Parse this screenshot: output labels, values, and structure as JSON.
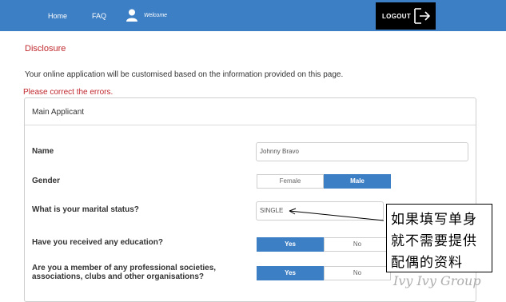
{
  "nav": {
    "home": "Home",
    "faq": "FAQ",
    "welcome": "Welcome",
    "logout": "LOGOUT",
    "user_icon": "user-icon",
    "logout_icon": "logout-arrow-icon"
  },
  "page": {
    "title": "Disclosure",
    "intro": "Your online application will be customised based on the information provided on this page.",
    "error": "Please correct the errors."
  },
  "panel": {
    "title": "Main Applicant",
    "name_label": "Name",
    "name_value": "Johnny Bravo",
    "gender_label": "Gender",
    "gender_options": [
      "Female",
      "Male"
    ],
    "gender_selected": "Male",
    "marital_label": "What is your marital status?",
    "marital_value": "SINGLE",
    "education_label": "Have you received any education?",
    "education_options": [
      "Yes",
      "No"
    ],
    "education_selected": "Yes",
    "member_label": "Are you a member of any professional societies, associations, clubs and other organisations?",
    "member_options": [
      "Yes",
      "No"
    ],
    "member_selected": "Yes"
  },
  "annotation": {
    "lines": [
      "如果填写单身",
      "就不需要提供",
      "配偶的资料"
    ],
    "watermark": "Ivy Ivy Group"
  },
  "colors": {
    "nav_bg": "#3d7fc4",
    "accent_blue": "#3d7fc4",
    "error_red": "#c0282e",
    "logout_bg": "#000000"
  }
}
